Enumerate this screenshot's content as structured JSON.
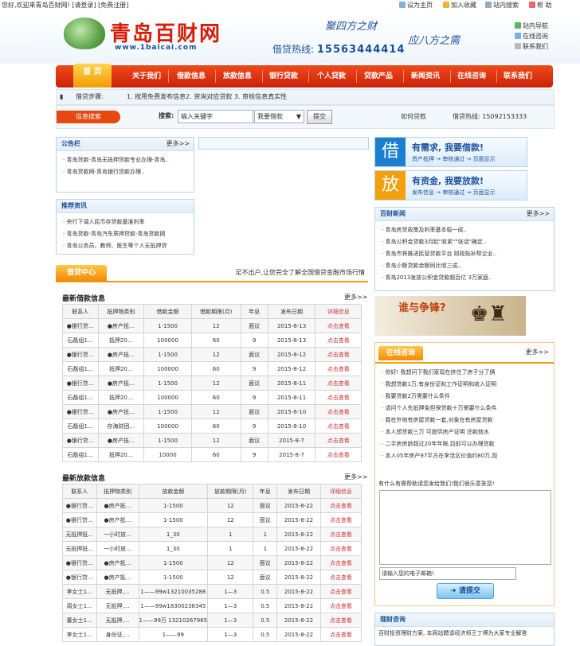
{
  "topbar": {
    "welcome": "您好,欢迎来青岛百财网! [请登录] [免费注册]",
    "set_home": "设为主页",
    "add_fav": "加入收藏",
    "site_search": "站内搜索",
    "help": "帮 助"
  },
  "header": {
    "logo_name": "青岛百财网",
    "logo_url": "www.1baicai.com",
    "slogan1": "聚四方之财",
    "slogan2": "应八方之需",
    "hotline_label": "借贷热线:",
    "hotline_number": "15563444414",
    "right_links": [
      "站内导航",
      "在线咨询",
      "联系我们"
    ]
  },
  "nav": {
    "items": [
      "首 页",
      "关于我们",
      "借款信息",
      "放款信息",
      "银行贷款",
      "个人贷款",
      "贷款产品",
      "新闻资讯",
      "在线咨询",
      "联系我们"
    ]
  },
  "steps": {
    "label": "借贷步骤:",
    "text": "1. 按用免费发布信息2. 资询对应贷款 3. 审核信息真实性",
    "right1": "如何贷款",
    "right2": "借贷热线: 15092153333"
  },
  "search": {
    "tab": "信息搜索",
    "label": "搜索:",
    "placeholder": "输入关键字",
    "select": "我要借款",
    "button": "提交"
  },
  "notice": {
    "title": "公告栏",
    "more": "更多>>",
    "items": [
      "青岛贷款-青岛无抵押贷款专业办理-青岛..",
      "青岛贷款网-青岛银行贷款办理.."
    ]
  },
  "recommend": {
    "title": "推荐资讯",
    "items": [
      "央行下调人民币存贷款基准利率",
      "青岛贷款-青岛汽车质押贷款-青岛贷款网",
      "青岛公务员、教师、医生等个人无抵押贷"
    ]
  },
  "loan_center": {
    "tag": "借贷中心",
    "text": "足不出户,让您完全了解全国借贷金融市场行情"
  },
  "borrow": {
    "title": "最新借款信息",
    "more": "更多>>",
    "headers": [
      "联系人",
      "抵押物类别",
      "借款金额",
      "借款期限(月)",
      "年息",
      "发布日期",
      "详细信息"
    ],
    "rows": [
      [
        "●银行贷…",
        "●房产抵…",
        "1-1500",
        "12",
        "面议",
        "2015-8-13",
        "点击查看"
      ],
      [
        "石磊组1…",
        "抵押20…",
        "100000",
        "60",
        "9",
        "2015-8-13",
        "点击查看"
      ],
      [
        "●银行贷…",
        "●房产抵…",
        "1-1500",
        "12",
        "面议",
        "2015-8-12",
        "点击查看"
      ],
      [
        "石磊组1…",
        "抵押20…",
        "100000",
        "60",
        "9",
        "2015-8-12",
        "点击查看"
      ],
      [
        "●银行贷…",
        "●房产抵…",
        "1-1500",
        "12",
        "面议",
        "2015-8-11",
        "点击查看"
      ],
      [
        "石磊组1…",
        "抵押20…",
        "100000",
        "60",
        "9",
        "2015-8-11",
        "点击查看"
      ],
      [
        "●银行贷…",
        "●房产抵…",
        "1-1500",
        "12",
        "面议",
        "2015-8-10",
        "点击查看"
      ],
      [
        "石磊组1…",
        "存海财团…",
        "100000",
        "60",
        "9",
        "2015-8-10",
        "点击查看"
      ],
      [
        "●银行贷…",
        "●房产抵…",
        "1-1500",
        "12",
        "面议",
        "2015-8-7",
        "点击查看"
      ],
      [
        "石磊组1…",
        "抵押20…",
        "10000",
        "60",
        "9",
        "2015-8-7",
        "点击查看"
      ]
    ]
  },
  "lend": {
    "title": "最新放款信息",
    "more": "更多>>",
    "headers": [
      "联系人",
      "抵押物类别",
      "放款金额",
      "放款期限(月)",
      "年息",
      "发布日期",
      "详细信息"
    ],
    "rows": [
      [
        "●银行贷…",
        "●房产抵…",
        "1-1500",
        "12",
        "面议",
        "2015-8-22",
        "点击查看"
      ],
      [
        "●银行贷…",
        "●房产抵…",
        "1-1500",
        "12",
        "面议",
        "2015-8-22",
        "点击查看"
      ],
      [
        "无抵押抵…",
        "一小时放…",
        "1_30",
        "1",
        "1",
        "2015-8-22",
        "点击查看"
      ],
      [
        "无抵押抵…",
        "一小时放…",
        "1_30",
        "1",
        "1",
        "2015-8-22",
        "点击查看"
      ],
      [
        "●银行贷…",
        "●房产抵…",
        "1-1500",
        "12",
        "面议",
        "2015-8-22",
        "点击查看"
      ],
      [
        "●银行贷…",
        "●房产抵…",
        "1-1500",
        "12",
        "面议",
        "2015-8-22",
        "点击查看"
      ],
      [
        "李女士1…",
        "无抵押,…",
        "1——99w13210035288",
        "1—3",
        "0.5",
        "2015-8-22",
        "点击查看"
      ],
      [
        "周女士1…",
        "无抵押,…",
        "1——99w18300238345",
        "1—3",
        "0.5",
        "2015-8-22",
        "点击查看"
      ],
      [
        "董女士1…",
        "无抵押,…",
        "1——99万 13210267965",
        "1—3",
        "0.5",
        "2015-8-22",
        "点击查看"
      ],
      [
        "李女士1…",
        "身份证,…",
        "1——99",
        "1—3",
        "0.5",
        "2015-8-22",
        "点击查看"
      ]
    ]
  },
  "promo_borrow": {
    "char": "借",
    "title": "有需求, 我要借款!",
    "steps": "资产抵押 → 审核通过 → 页面显示"
  },
  "promo_lend": {
    "char": "放",
    "title": "有资金, 我要放款!",
    "steps": "发布信息 → 审核通过 → 页面显示"
  },
  "news": {
    "title": "百财新闻",
    "more": "更多>>",
    "items": [
      "青岛房贷政策及利率基本稳一成..",
      "青岛公积金贷款3月起\"收紧\"\"张话\"确定..",
      "青岛市将推进民营贷款平台 财政贴补帮企业..",
      "青岛小额贷款余额同比增三成..",
      "青岛2013发放公积金贷款超百亿 3万家庭.."
    ]
  },
  "chess": {
    "title": "谁与争锋?"
  },
  "consult": {
    "tag": "在线咨询",
    "more": "更多>>",
    "items": [
      "你好! 我想问下我们家现在挤住了房子分了俩",
      "我想贷款1万,有身份证和工作证明和收入证明",
      "我要贷款2万需要什么条件",
      "请问个人先抵押免担保贷款十万需要什么条件",
      "我在外地有房屋贷款一套,对象在有房屋贷款",
      "本人想贷款三万 可提供房产证明 还款就水",
      "二手房房龄超过20年年限,目前可以办理贷款",
      "本人05年房产97平方在李沧区价值约80万,现"
    ],
    "note": "有什么有需帮助请您发给我们!我们很乐意答您!",
    "email_placeholder": "请输入您的电子邮箱!",
    "submit": "请提交"
  },
  "manage": {
    "title": "理财咨询",
    "text": "百财投资理财方案, 本网站聘请经济师王丁博为大家专业解答"
  }
}
